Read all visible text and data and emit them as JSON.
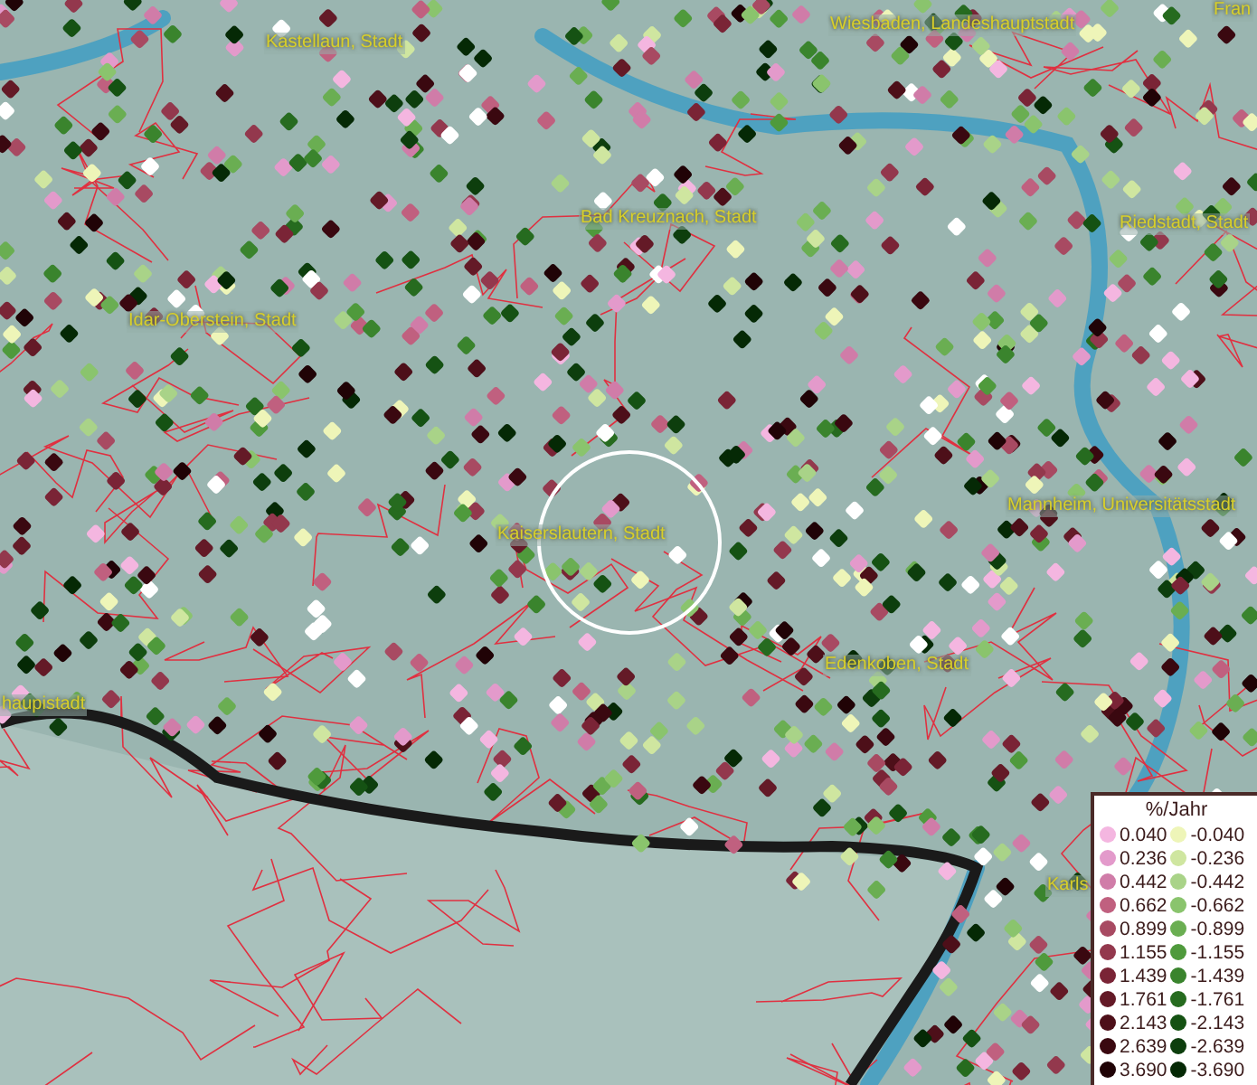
{
  "map": {
    "labels": [
      "Kastellaun, Stadt",
      "Wiesbaden, Landeshauptstadt",
      "Fran",
      "Bad Kreuznach, Stadt",
      "Riedstadt, Stadt",
      "Idar-Oberstein, Stadt",
      "Kaiserslautern, Stadt",
      "Mannheim, Universitätsstadt",
      "haupistadt",
      "Edenkoben, Stadt",
      "Karls"
    ]
  },
  "legend": {
    "title": "%/Jahr",
    "positive": [
      {
        "label": "0.040",
        "color": "#f4b6e0"
      },
      {
        "label": "0.236",
        "color": "#e39acb"
      },
      {
        "label": "0.442",
        "color": "#d07ca8"
      },
      {
        "label": "0.662",
        "color": "#c0607f"
      },
      {
        "label": "0.899",
        "color": "#a84a62"
      },
      {
        "label": "1.155",
        "color": "#93384d"
      },
      {
        "label": "1.439",
        "color": "#7a2436"
      },
      {
        "label": "1.761",
        "color": "#641a27"
      },
      {
        "label": "2.143",
        "color": "#4d0f19"
      },
      {
        "label": "2.639",
        "color": "#3a0810"
      },
      {
        "label": "3.690",
        "color": "#200306"
      }
    ],
    "negative": [
      {
        "label": "-0.040",
        "color": "#eef5b8"
      },
      {
        "label": "-0.236",
        "color": "#cfe6a0"
      },
      {
        "label": "-0.442",
        "color": "#a9d388"
      },
      {
        "label": "-0.662",
        "color": "#8ac46d"
      },
      {
        "label": "-0.899",
        "color": "#6aae52"
      },
      {
        "label": "-1.155",
        "color": "#4f9a3c"
      },
      {
        "label": "-1.439",
        "color": "#3a842d"
      },
      {
        "label": "-1.761",
        "color": "#266b1f"
      },
      {
        "label": "-2.143",
        "color": "#155213"
      },
      {
        "label": "-2.639",
        "color": "#0d3e0d"
      },
      {
        "label": "-3.690",
        "color": "#052905"
      }
    ]
  }
}
